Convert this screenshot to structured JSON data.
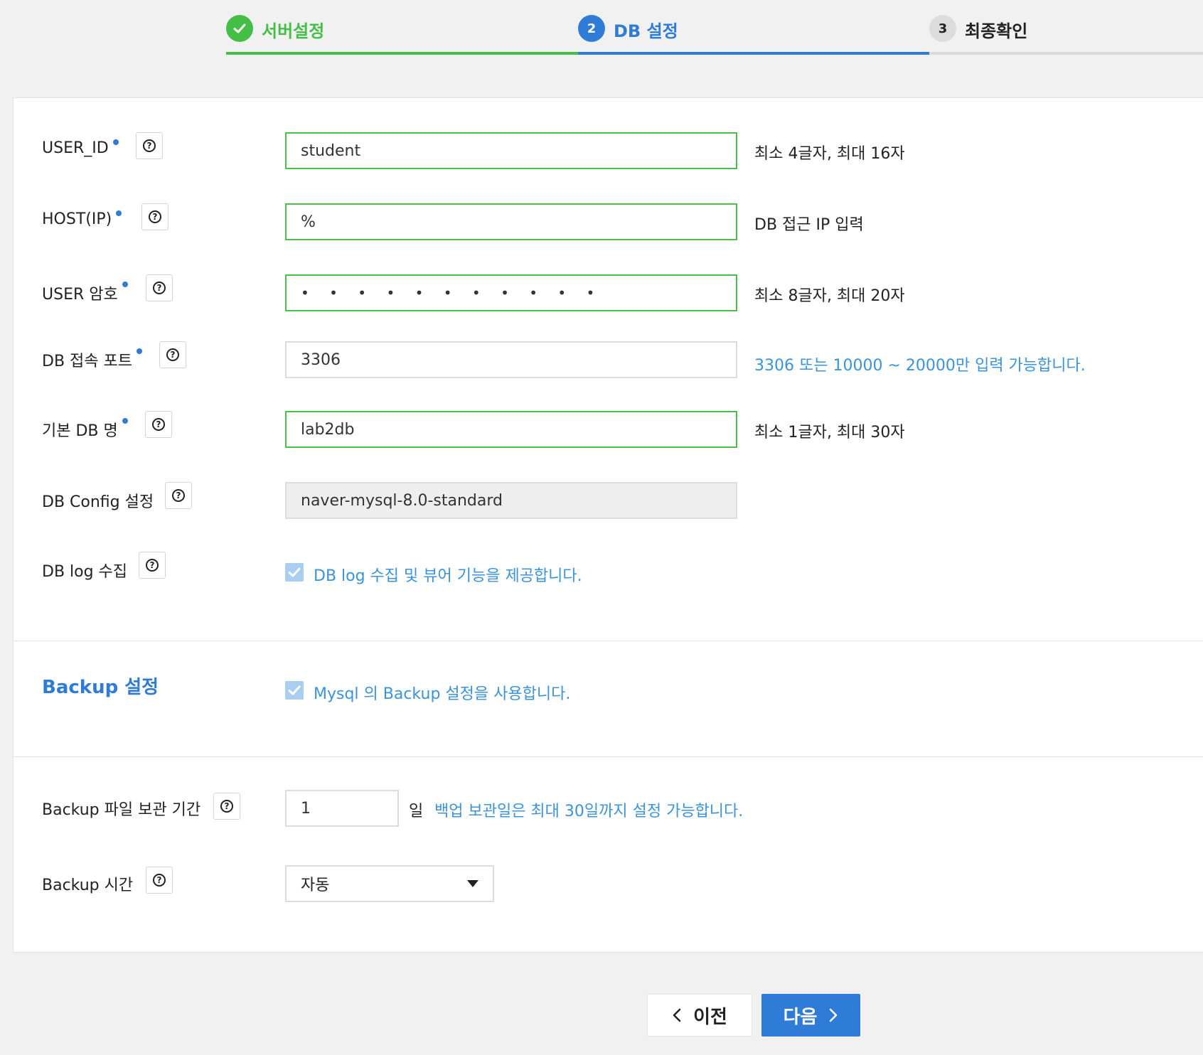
{
  "stepper": {
    "steps": [
      {
        "number": "",
        "label": "서버설정",
        "state": "done"
      },
      {
        "number": "2",
        "label": "DB 설정",
        "state": "active"
      },
      {
        "number": "3",
        "label": "최종확인",
        "state": "pending"
      }
    ]
  },
  "form": {
    "user_id": {
      "label": "USER_ID",
      "value": "student",
      "hint": "최소 4글자, 최대 16자"
    },
    "host": {
      "label": "HOST(IP)",
      "value": "%",
      "hint": "DB 접근 IP 입력"
    },
    "password": {
      "label": "USER 암호",
      "value": "• • • • • • • • • • •",
      "hint": "최소 8글자, 최대 20자"
    },
    "port": {
      "label": "DB 접속 포트",
      "value": "3306",
      "hint": "3306 또는 10000 ~ 20000만 입력 가능합니다."
    },
    "db_name": {
      "label": "기본 DB 명",
      "value": "lab2db",
      "hint": "최소 1글자, 최대 30자"
    },
    "db_config": {
      "label": "DB Config 설정",
      "value": "naver-mysql-8.0-standard"
    },
    "db_log": {
      "label": "DB log 수집",
      "checked": true,
      "text": "DB log 수집 및 뷰어 기능을 제공합니다."
    }
  },
  "backup": {
    "title": "Backup 설정",
    "enabled": true,
    "enable_text": "Mysql 의 Backup 설정을 사용합니다.",
    "retention": {
      "label": "Backup 파일 보관 기간",
      "value": "1",
      "unit": "일",
      "hint": "백업 보관일은 최대 30일까지 설정 가능합니다."
    },
    "time": {
      "label": "Backup 시간",
      "value": "자동"
    }
  },
  "buttons": {
    "prev": "이전",
    "next": "다음"
  },
  "colors": {
    "primary": "#2f7bd8",
    "success": "#43bf45",
    "link": "#3a93db"
  }
}
